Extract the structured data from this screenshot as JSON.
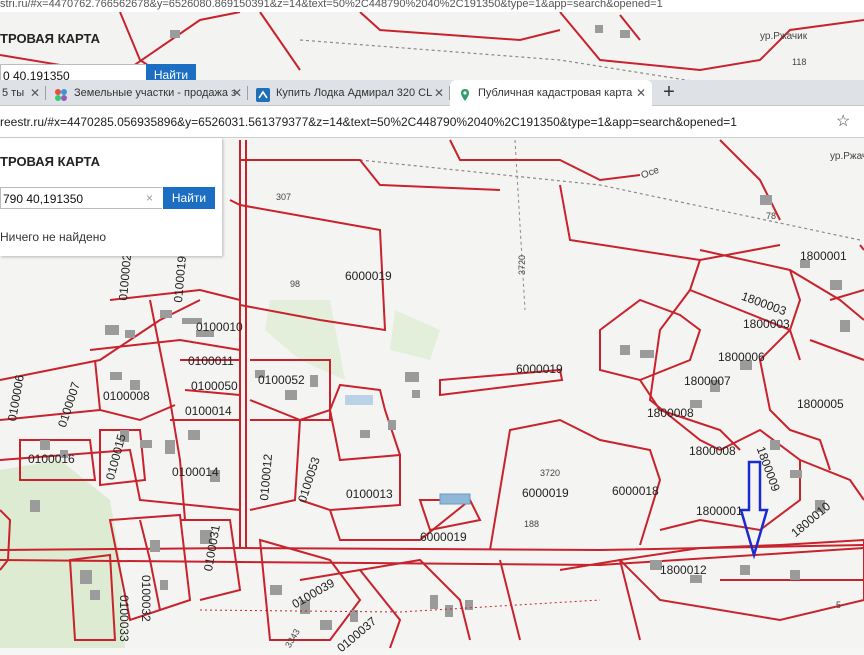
{
  "back_window": {
    "url_fragment": "stri.ru/#x=4470762.766562678&y=6526080.869150391&z=14&text=50%2C448790%2040%2C191350&type=1&app=search&opened=1",
    "panel_title": "ТРОВАЯ КАРТА",
    "search_value": "0 40,191350",
    "search_button": "Найти"
  },
  "tabs": [
    {
      "label": "5 ты",
      "icon": "page-icon",
      "active": false
    },
    {
      "label": "Земельные участки - продажа з",
      "icon": "colorful-dots-icon",
      "active": false
    },
    {
      "label": "Купить Лодка Адмирал 320 CL",
      "icon": "avito-icon",
      "active": false
    },
    {
      "label": "Публичная кадастровая карта",
      "icon": "pin-icon",
      "active": true
    }
  ],
  "new_tab_symbol": "+",
  "address_bar": {
    "url": "reestr.ru/#x=4470285.056935896&y=6526031.561379377&z=14&text=50%2C448790%2040%2C191350&type=1&app=search&opened=1",
    "bookmark_symbol": "☆"
  },
  "front_panel": {
    "title": "ТРОВАЯ КАРТА",
    "search_value": "790 40,191350",
    "clear_symbol": "×",
    "search_button": "Найти",
    "message": "Ничего не найдено"
  },
  "colors": {
    "parcel_border": "#c8232c",
    "arrow": "#1a2bd1",
    "accent_button": "#1b6ec2"
  },
  "parcel_labels": [
    "0100010",
    "0100011",
    "0100050",
    "0100014",
    "0100008",
    "0100007",
    "0100006",
    "0100016",
    "0100015",
    "0100014",
    "0100012",
    "0100052",
    "0100053",
    "0100013",
    "0100032",
    "0100033",
    "0100031",
    "0100039",
    "0100037",
    "0100002",
    "0100019",
    "6000019",
    "6000019",
    "6000019",
    "6000019",
    "6000018",
    "1800001",
    "1800003",
    "1800003",
    "1800006",
    "1800007",
    "1800008",
    "1800005",
    "1800008",
    "1800009",
    "1800001",
    "1800012",
    "1800010"
  ],
  "map_small_labels": [
    "307",
    "98",
    "3720",
    "3720",
    "188",
    "78",
    "118",
    "ур.Ржачик",
    "ур.Ржачик",
    "Осе",
    "5",
    "3343"
  ],
  "arrow_icon": "down-arrow-icon"
}
